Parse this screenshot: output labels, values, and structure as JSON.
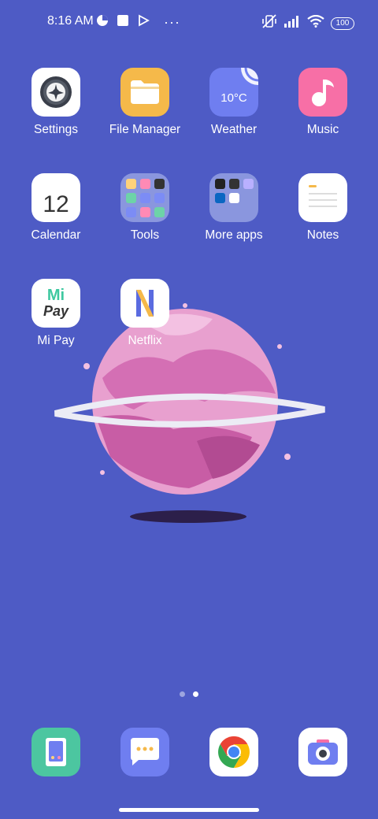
{
  "status_bar": {
    "time": "8:16 AM",
    "left_icons": [
      "data-saver-icon",
      "square-notification-icon",
      "play-store-icon",
      "more-dots-icon"
    ],
    "right_icons": [
      "vibrate-muted-icon",
      "signal-icon",
      "wifi-icon"
    ],
    "battery": "100"
  },
  "apps": {
    "settings": {
      "label": "Settings",
      "icon": "settings-icon"
    },
    "file_manager": {
      "label": "File Manager",
      "icon": "folder-icon"
    },
    "weather": {
      "label": "Weather",
      "icon": "weather-icon",
      "temp": "10°C"
    },
    "music": {
      "label": "Music",
      "icon": "music-note-icon"
    },
    "calendar": {
      "label": "Calendar",
      "icon": "calendar-icon",
      "day": "12"
    },
    "tools": {
      "label": "Tools",
      "icon": "folder-icon"
    },
    "more_apps": {
      "label": "More apps",
      "icon": "folder-icon"
    },
    "notes": {
      "label": "Notes",
      "icon": "notes-icon"
    },
    "mi_pay": {
      "label": "Mi Pay",
      "icon": "mi-pay-icon",
      "logo_top": "Mi",
      "logo_bottom": "Pay"
    },
    "netflix": {
      "label": "Netflix",
      "icon": "netflix-icon",
      "logo": "N"
    }
  },
  "page_indicator": {
    "count": 2,
    "active": 2
  },
  "dock": [
    {
      "name": "phone-manager",
      "icon": "security-app-icon"
    },
    {
      "name": "messaging",
      "icon": "message-icon"
    },
    {
      "name": "chrome",
      "icon": "chrome-icon"
    },
    {
      "name": "camera",
      "icon": "camera-icon"
    }
  ],
  "colors": {
    "wallpaper": "#4e5bc5",
    "music_icon": "#f76fa6",
    "file_manager_icon": "#f5b94a",
    "weather_icon": "#6f7ef0",
    "security_icon": "#4cc6a0",
    "messaging_icon": "#6f7ef0",
    "planet_pink": "#e58fc4"
  }
}
